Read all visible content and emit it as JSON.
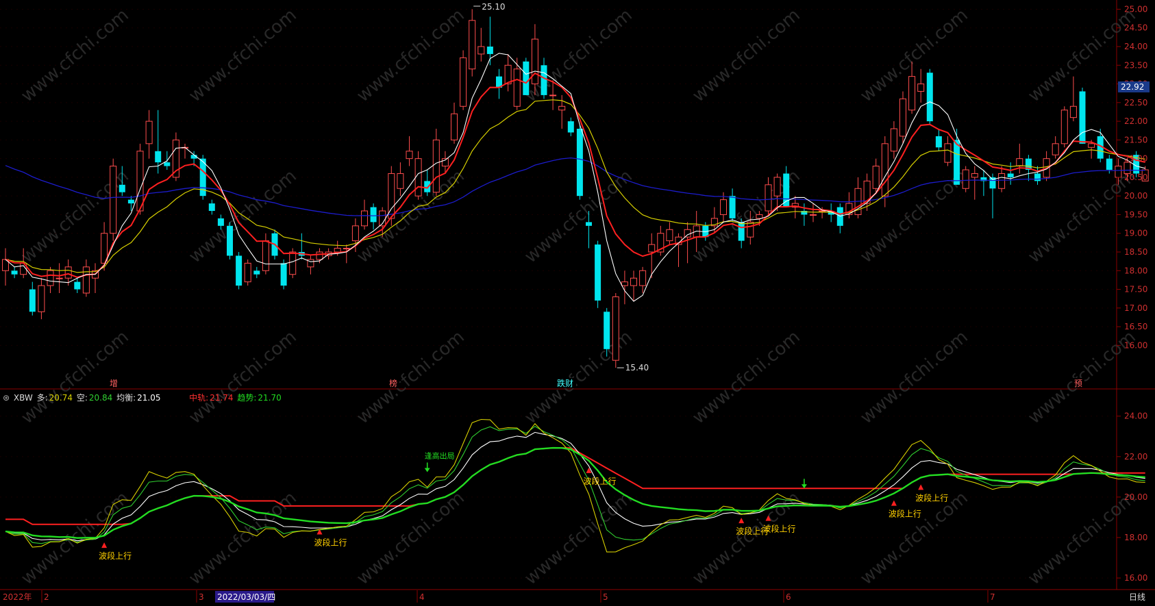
{
  "colors": {
    "background": "#000000",
    "frame": "#8b0000",
    "candle_up": "#ff4d4d",
    "candle_down": "#00e5ee",
    "ma5": "#ffffff",
    "ma10": "#ff2020",
    "ma20": "#d8d000",
    "ma60": "#1c1ccc",
    "trend": "#22dd22",
    "midrail": "#ff2020",
    "multi": "#d8d000",
    "short": "#30d030",
    "balance": "#ffffff",
    "signal_up": "#ff2020",
    "signal_text": "#ffd000",
    "signal_down": "#22dd22",
    "axis_text": "#d03030",
    "date_text": "#d03030"
  },
  "price_axis": {
    "ticks": [
      "25.00",
      "24.50",
      "24.00",
      "23.50",
      "23.00",
      "22.50",
      "22.00",
      "21.50",
      "21.00",
      "20.50",
      "20.00",
      "19.50",
      "19.00",
      "18.50",
      "18.00",
      "17.50",
      "17.00",
      "16.50",
      "16.00"
    ],
    "current": "22.92"
  },
  "price_annotations": {
    "high": "25.10",
    "low": "15.40"
  },
  "event_markers": [
    "增",
    "榜",
    "跌财",
    "预"
  ],
  "indicator": {
    "name": "XBW",
    "multi_label": "多:",
    "multi_value": "20.74",
    "short_label": "空:",
    "short_value": "20.84",
    "balance_label": "均衡:",
    "balance_value": "21.05",
    "mid_label": "中轨:",
    "mid_value": "21.74",
    "trend_label": "趋势:",
    "trend_value": "21.70",
    "axis_ticks": [
      "24.00",
      "22.00",
      "20.00",
      "18.00",
      "16.00"
    ],
    "signal_label": "波段上行",
    "top_signal_label": "逢高出局"
  },
  "date_axis": {
    "year": "2022年",
    "months": [
      "2",
      "3",
      "4",
      "5",
      "6",
      "7"
    ],
    "cursor_date": "2022/03/03/四",
    "period": "日线"
  },
  "chart_data": {
    "type": "candlestick",
    "ylim": [
      15.2,
      25.1
    ],
    "high_mark": 25.1,
    "low_mark": 15.4,
    "ohlc": [
      [
        18.0,
        18.6,
        17.6,
        18.3
      ],
      [
        18.0,
        18.1,
        17.8,
        17.9
      ],
      [
        17.9,
        18.6,
        17.8,
        18.2
      ],
      [
        17.5,
        17.7,
        16.8,
        16.9
      ],
      [
        16.9,
        17.8,
        16.7,
        17.6
      ],
      [
        17.6,
        18.1,
        17.4,
        18.0
      ],
      [
        17.8,
        18.2,
        17.4,
        17.8
      ],
      [
        17.8,
        18.3,
        17.6,
        18.1
      ],
      [
        17.7,
        17.8,
        17.4,
        17.5
      ],
      [
        17.4,
        18.3,
        17.3,
        18.1
      ],
      [
        17.8,
        18.2,
        17.4,
        18.0
      ],
      [
        18.2,
        19.3,
        18.0,
        19.0
      ],
      [
        19.0,
        21.0,
        18.8,
        20.8
      ],
      [
        20.3,
        20.8,
        20.0,
        20.1
      ],
      [
        19.9,
        20.0,
        19.6,
        19.8
      ],
      [
        19.6,
        21.4,
        19.5,
        21.2
      ],
      [
        21.4,
        22.3,
        21.0,
        22.0
      ],
      [
        21.2,
        22.3,
        20.6,
        20.9
      ],
      [
        20.9,
        21.2,
        20.7,
        20.8
      ],
      [
        20.5,
        21.7,
        20.4,
        21.5
      ],
      [
        21.3,
        21.4,
        21.0,
        21.3
      ],
      [
        21.1,
        21.2,
        20.8,
        21.0
      ],
      [
        21.0,
        21.1,
        19.9,
        20.0
      ],
      [
        19.8,
        19.9,
        19.5,
        19.6
      ],
      [
        19.4,
        19.5,
        19.1,
        19.2
      ],
      [
        19.2,
        19.3,
        18.3,
        18.4
      ],
      [
        18.4,
        18.5,
        17.5,
        17.6
      ],
      [
        17.7,
        18.3,
        17.6,
        18.2
      ],
      [
        18.0,
        18.1,
        17.8,
        17.9
      ],
      [
        18.0,
        19.0,
        17.9,
        18.8
      ],
      [
        19.0,
        19.1,
        18.3,
        18.4
      ],
      [
        18.2,
        18.3,
        17.5,
        17.6
      ],
      [
        17.9,
        18.6,
        17.8,
        18.5
      ],
      [
        18.5,
        19.0,
        18.3,
        18.4
      ],
      [
        18.1,
        18.4,
        17.9,
        18.3
      ],
      [
        18.3,
        18.6,
        18.2,
        18.5
      ],
      [
        18.4,
        18.6,
        18.3,
        18.5
      ],
      [
        18.5,
        18.8,
        18.4,
        18.6
      ],
      [
        18.6,
        18.7,
        18.2,
        18.6
      ],
      [
        18.8,
        19.4,
        18.5,
        19.2
      ],
      [
        19.2,
        19.9,
        19.1,
        19.6
      ],
      [
        19.7,
        19.8,
        19.1,
        19.3
      ],
      [
        19.2,
        19.7,
        18.9,
        19.6
      ],
      [
        19.4,
        20.8,
        19.2,
        20.6
      ],
      [
        20.2,
        20.9,
        20.0,
        20.6
      ],
      [
        21.0,
        21.6,
        20.8,
        21.2
      ],
      [
        20.0,
        21.2,
        19.9,
        21.0
      ],
      [
        20.4,
        20.7,
        20.0,
        20.1
      ],
      [
        20.1,
        21.8,
        20.0,
        21.5
      ],
      [
        20.8,
        21.2,
        20.6,
        21.0
      ],
      [
        21.5,
        22.5,
        21.4,
        22.2
      ],
      [
        22.4,
        23.9,
        22.3,
        23.7
      ],
      [
        23.4,
        25.0,
        23.2,
        24.7
      ],
      [
        23.8,
        24.5,
        23.6,
        24.0
      ],
      [
        24.0,
        24.8,
        23.5,
        23.8
      ],
      [
        23.2,
        23.4,
        22.6,
        22.9
      ],
      [
        23.0,
        23.8,
        22.8,
        23.5
      ],
      [
        22.4,
        23.7,
        22.3,
        23.4
      ],
      [
        23.6,
        23.7,
        22.7,
        22.7
      ],
      [
        23.0,
        24.6,
        22.7,
        24.2
      ],
      [
        23.5,
        23.7,
        22.6,
        22.7
      ],
      [
        22.7,
        23.1,
        22.3,
        22.7
      ],
      [
        22.3,
        22.7,
        21.8,
        22.4
      ],
      [
        22.0,
        22.1,
        21.6,
        21.7
      ],
      [
        21.8,
        21.9,
        19.9,
        20.0
      ],
      [
        19.3,
        19.6,
        18.6,
        19.2
      ],
      [
        18.7,
        18.8,
        17.0,
        17.2
      ],
      [
        16.9,
        17.0,
        15.7,
        15.9
      ],
      [
        15.6,
        17.4,
        15.4,
        17.3
      ],
      [
        17.6,
        18.0,
        17.1,
        17.7
      ],
      [
        17.6,
        18.0,
        17.2,
        17.8
      ],
      [
        17.6,
        18.1,
        17.4,
        18.0
      ],
      [
        18.5,
        19.0,
        17.8,
        18.7
      ],
      [
        18.5,
        19.2,
        18.4,
        19.0
      ],
      [
        18.8,
        19.3,
        18.7,
        19.1
      ],
      [
        18.7,
        19.0,
        18.1,
        18.9
      ],
      [
        18.9,
        19.3,
        18.2,
        19.1
      ],
      [
        18.9,
        19.6,
        18.5,
        19.2
      ],
      [
        19.2,
        19.3,
        18.8,
        18.9
      ],
      [
        19.2,
        19.7,
        19.0,
        19.4
      ],
      [
        19.5,
        20.1,
        19.3,
        19.9
      ],
      [
        20.0,
        20.2,
        19.3,
        19.4
      ],
      [
        19.3,
        19.4,
        18.6,
        18.8
      ],
      [
        18.9,
        19.6,
        18.7,
        19.3
      ],
      [
        19.4,
        19.6,
        19.2,
        19.5
      ],
      [
        19.6,
        20.5,
        19.5,
        20.3
      ],
      [
        20.0,
        20.6,
        19.6,
        20.5
      ],
      [
        20.6,
        20.8,
        19.7,
        19.7
      ],
      [
        19.7,
        20.0,
        19.4,
        19.8
      ],
      [
        19.6,
        19.8,
        19.2,
        19.5
      ],
      [
        19.5,
        19.8,
        19.3,
        19.5
      ],
      [
        19.6,
        19.7,
        19.4,
        19.6
      ],
      [
        19.6,
        19.8,
        19.3,
        19.5
      ],
      [
        19.7,
        19.8,
        19.0,
        19.2
      ],
      [
        19.5,
        20.1,
        19.4,
        19.8
      ],
      [
        19.5,
        20.5,
        19.4,
        20.2
      ],
      [
        19.8,
        20.6,
        19.6,
        20.4
      ],
      [
        20.2,
        21.0,
        20.1,
        20.8
      ],
      [
        20.0,
        21.6,
        19.7,
        21.4
      ],
      [
        21.2,
        22.0,
        21.0,
        21.8
      ],
      [
        21.6,
        22.8,
        21.4,
        22.6
      ],
      [
        22.3,
        23.6,
        22.2,
        23.2
      ],
      [
        22.8,
        23.4,
        22.5,
        23.0
      ],
      [
        23.3,
        23.4,
        21.9,
        22.0
      ],
      [
        21.6,
        21.8,
        21.2,
        21.3
      ],
      [
        20.9,
        21.6,
        20.8,
        21.4
      ],
      [
        21.5,
        21.8,
        20.3,
        20.3
      ],
      [
        20.2,
        20.8,
        20.1,
        20.7
      ],
      [
        20.5,
        20.8,
        19.9,
        20.6
      ],
      [
        20.5,
        20.7,
        20.0,
        20.4
      ],
      [
        20.5,
        20.6,
        19.4,
        20.2
      ],
      [
        20.2,
        20.8,
        20.1,
        20.6
      ],
      [
        20.6,
        20.9,
        20.3,
        20.5
      ],
      [
        20.8,
        21.4,
        20.6,
        21.0
      ],
      [
        21.0,
        21.1,
        20.4,
        20.7
      ],
      [
        20.6,
        20.8,
        20.3,
        20.4
      ],
      [
        20.5,
        21.2,
        20.4,
        21.0
      ],
      [
        21.1,
        21.6,
        21.0,
        21.4
      ],
      [
        21.4,
        22.4,
        21.3,
        22.3
      ],
      [
        22.1,
        23.2,
        22.0,
        22.4
      ],
      [
        22.8,
        22.9,
        21.4,
        21.4
      ],
      [
        21.3,
        21.5,
        21.0,
        21.4
      ],
      [
        21.6,
        21.8,
        20.9,
        21.0
      ],
      [
        21.0,
        21.1,
        20.6,
        20.7
      ],
      [
        20.5,
        21.0,
        20.3,
        20.8
      ],
      [
        20.6,
        21.0,
        20.4,
        20.9
      ],
      [
        21.1,
        21.2,
        20.5,
        20.6
      ],
      [
        20.4,
        20.8,
        20.4,
        20.7
      ]
    ],
    "indicator_ylim": [
      15.8,
      24.6
    ]
  }
}
